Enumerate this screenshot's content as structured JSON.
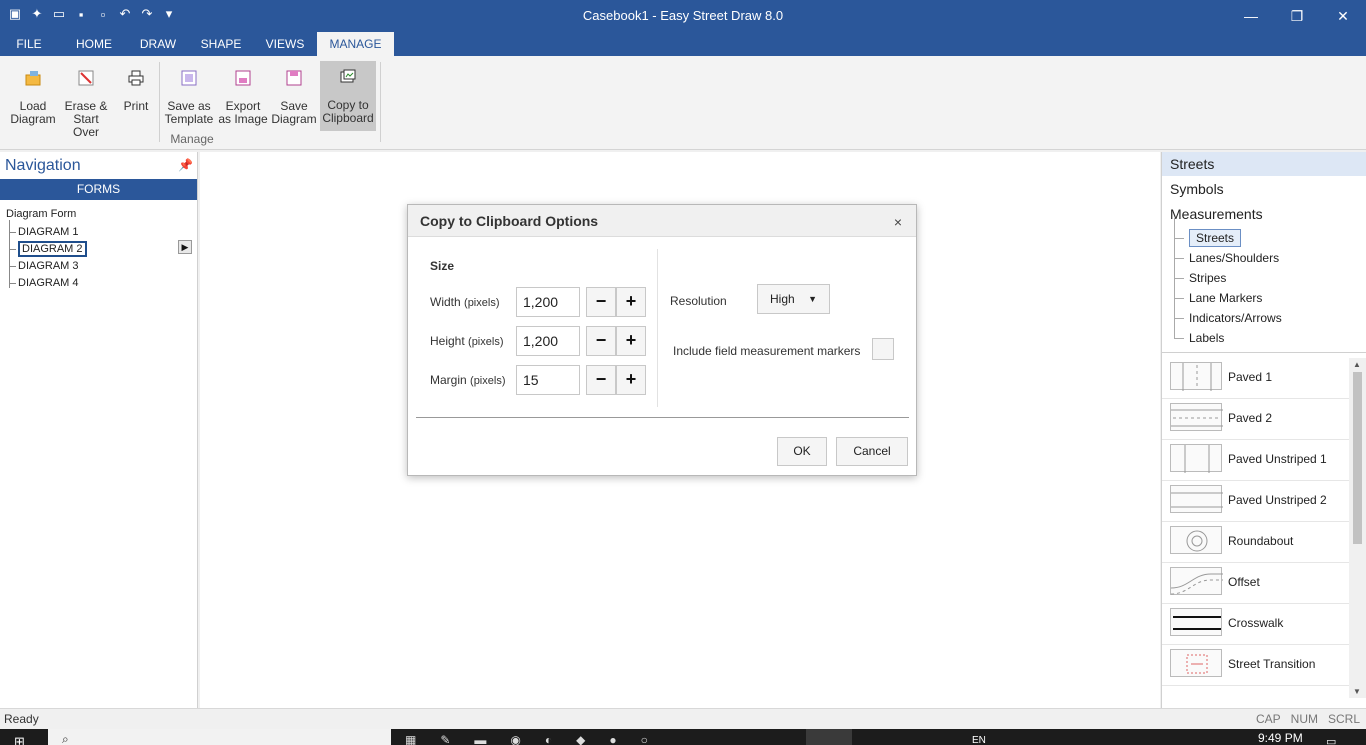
{
  "window": {
    "title": "Casebook1 - Easy Street Draw 8.0",
    "minimize": "—",
    "restore": "❐",
    "close": "✕"
  },
  "tabs": [
    "FILE",
    "HOME",
    "DRAW",
    "SHAPE",
    "VIEWS",
    "MANAGE"
  ],
  "active_tab": "MANAGE",
  "ribbon": {
    "buttons": [
      {
        "line1": "Load",
        "line2": "Diagram",
        "icon": "load-diagram-icon"
      },
      {
        "line1": "Erase &",
        "line2": "Start Over",
        "icon": "erase-icon"
      },
      {
        "line1": "Print",
        "line2": "",
        "icon": "printer-icon"
      },
      {
        "line1": "Save as",
        "line2": "Template",
        "icon": "template-icon"
      },
      {
        "line1": "Export",
        "line2": "as Image",
        "icon": "export-image-icon"
      },
      {
        "line1": "Save",
        "line2": "Diagram",
        "icon": "save-icon"
      },
      {
        "line1": "Copy to",
        "line2": "Clipboard",
        "icon": "clipboard-icon"
      }
    ],
    "group_label": "Manage"
  },
  "navigation": {
    "title": "Navigation",
    "forms_label": "FORMS",
    "tree_root": "Diagram Form",
    "items": [
      "DIAGRAM 1",
      "DIAGRAM 2",
      "DIAGRAM 3",
      "DIAGRAM 4"
    ],
    "selected": "DIAGRAM 2"
  },
  "right_panel": {
    "categories": [
      "Streets",
      "Symbols",
      "Measurements"
    ],
    "active_category": "Streets",
    "subitems": [
      "Streets",
      "Lanes/Shoulders",
      "Stripes",
      "Lane Markers",
      "Indicators/Arrows",
      "Labels"
    ],
    "shapes": [
      "Paved 1",
      "Paved 2",
      "Paved Unstriped 1",
      "Paved Unstriped 2",
      "Roundabout",
      "Offset",
      "Crosswalk",
      "Street Transition"
    ]
  },
  "dialog": {
    "title": "Copy to Clipboard Options",
    "size_heading": "Size",
    "width_label": "Width",
    "height_label": "Height",
    "margin_label": "Margin",
    "unit": "(pixels)",
    "width_value": "1,200",
    "height_value": "1,200",
    "margin_value": "15",
    "minus": "−",
    "plus": "+",
    "resolution_label": "Resolution",
    "resolution_value": "High",
    "include_markers_label": "Include field measurement markers",
    "ok": "OK",
    "cancel": "Cancel",
    "close": "×"
  },
  "status": {
    "text": "Ready",
    "keys": [
      "CAP",
      "NUM",
      "SCRL"
    ]
  },
  "taskbar": {
    "time": "9:49 PM",
    "lang": "EN"
  }
}
